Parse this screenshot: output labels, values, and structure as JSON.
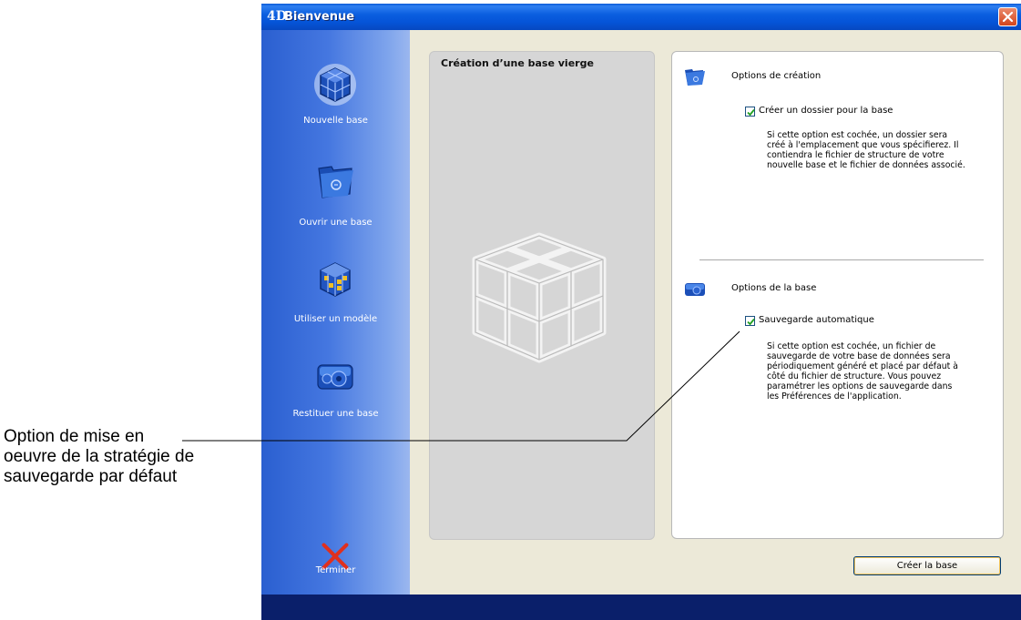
{
  "window": {
    "title": "Bienvenue",
    "logo": "4D"
  },
  "sidebar": {
    "items": [
      {
        "label": "Nouvelle base",
        "icon": "new-database-cube-icon"
      },
      {
        "label": "Ouvrir une base",
        "icon": "open-folder-icon"
      },
      {
        "label": "Utiliser un modèle",
        "icon": "template-cube-icon"
      },
      {
        "label": "Restituer une base",
        "icon": "restore-disk-icon"
      },
      {
        "label": "Terminer",
        "icon": "red-x-icon"
      }
    ]
  },
  "preview": {
    "title": "Création d’une base vierge"
  },
  "options": {
    "creation": {
      "heading": "Options de création",
      "checkbox_label": "Créer un dossier pour la base",
      "checked": true,
      "description": [
        "Si cette option est cochée, un dossier sera",
        "créé à l'emplacement que vous spécifierez. Il",
        "contiendra le fichier de structure de votre",
        "nouvelle base et le fichier de données associé."
      ]
    },
    "base": {
      "heading": "Options de la base",
      "checkbox_label": "Sauvegarde automatique",
      "checked": true,
      "description": [
        "Si cette option est cochée, un fichier de",
        "sauvegarde de votre base de données sera",
        "périodiquement généré et placé par défaut à",
        "côté du fichier de structure. Vous pouvez",
        "paramétrer les options de sauvegarde dans",
        "les Préférences de l'application."
      ]
    }
  },
  "buttons": {
    "create": "Créer la base"
  },
  "callout": {
    "lines": [
      "Option de mise en",
      "oeuvre de la stratégie de",
      "sauvegarde par défaut"
    ]
  },
  "colors": {
    "titlebar": "#0554d8",
    "sidebar": "#4577e0",
    "bottom_bar": "#0a1f6a",
    "close": "#d4441c"
  }
}
